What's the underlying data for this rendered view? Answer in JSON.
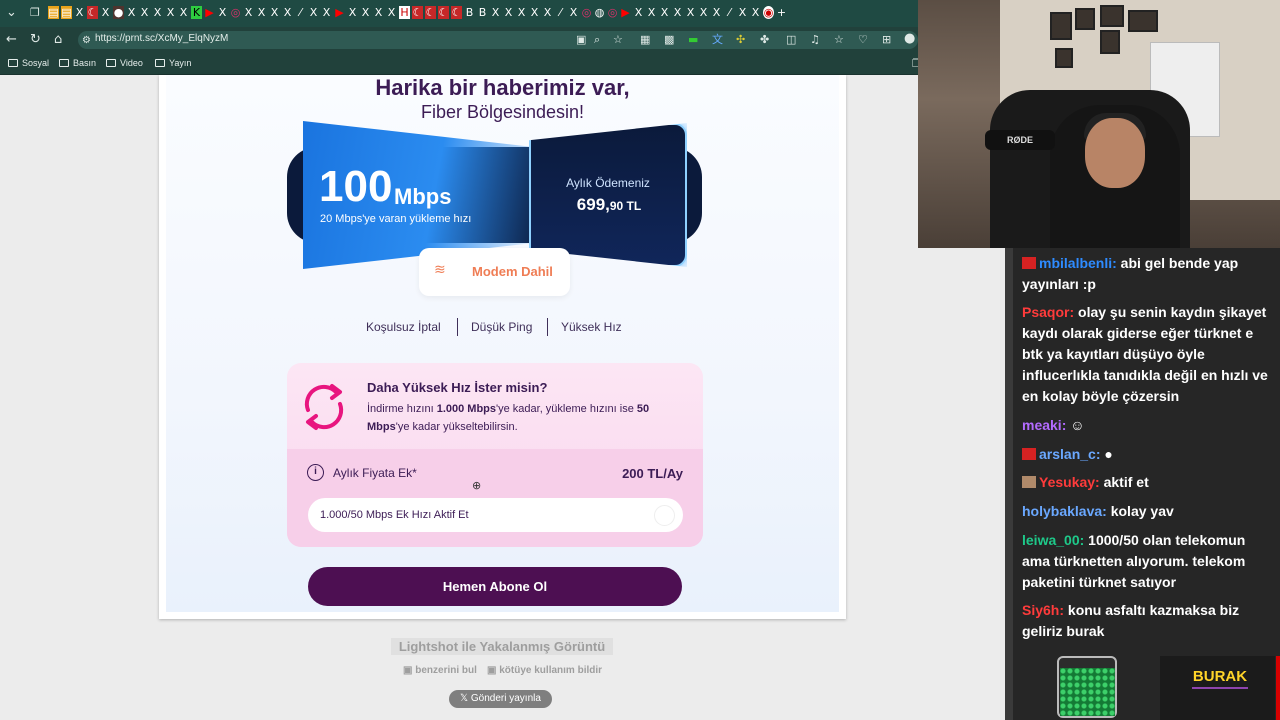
{
  "browser": {
    "url": "https://prnt.sc/XcMy_ElqNyzM",
    "bookmarks": [
      "Sosyal",
      "Basın",
      "Video",
      "Yayın"
    ]
  },
  "offer": {
    "headline": "Harika bir haberimiz var,",
    "subheadline": "Fiber Bölgesindesin!",
    "speed_value": "100",
    "speed_unit": "Mbps",
    "upload_text": "20 Mbps'ye varan yükleme hızı",
    "price_label": "Aylık Ödemeniz",
    "price_main": "699,",
    "price_decimals": "90 TL",
    "modem_label": "Modem Dahil",
    "features": [
      "Koşulsuz İptal",
      "Düşük Ping",
      "Yüksek Hız"
    ]
  },
  "upgrade": {
    "title": "Daha Yüksek Hız İster misin?",
    "desc_a": "İndirme hızını ",
    "desc_b": "1.000 Mbps",
    "desc_c": "'ye kadar, yükleme hızını ise ",
    "desc_d": "50 Mbps",
    "desc_e": "'ye kadar yükseltebilirsin.",
    "extra_label": "Aylık Fiyata Ek*",
    "extra_value": "200 TL/Ay",
    "toggle_label": "1.000/50 Mbps Ek Hızı Aktif Et",
    "subscribe_label": "Hemen Abone Ol"
  },
  "lightshot": {
    "title": "Lightshot ile Yakalanmış Görüntü",
    "find_similar": "benzerini bul",
    "report": "kötüye kullanım bildir",
    "post": "Gönderi yayınla"
  },
  "webcam": {
    "mic_label": "RØDE"
  },
  "chat": [
    {
      "user": "mbilalbenli:",
      "text": " abi gel bende yap yayınları :p",
      "color": "#2e8bff"
    },
    {
      "user": "Psaqor:",
      "text": " olay şu senin kaydın şikayet kaydı olarak giderse eğer türknet e btk ya kayıtları düşüyo öyle influcerlıkla tanıdıkla değil en hızlı ve en kolay böyle çözersin",
      "color": "#ff3b3b"
    },
    {
      "user": "meaki:",
      "text": "",
      "color": "#b36bff"
    },
    {
      "user": "arslan_c:",
      "text": "",
      "color": "#6aa8ff"
    },
    {
      "user": "Yesukay:",
      "text": " aktif et",
      "color": "#ff3b3b"
    },
    {
      "user": "holybaklava:",
      "text": " kolay yav",
      "color": "#6aa8ff"
    },
    {
      "user": "leiwa_00:",
      "text": " 1000/50 olan telekomun ama türknetten alıyorum. telekom paketini türknet satıyor",
      "color": "#1ec98a"
    },
    {
      "user": "Siy6h:",
      "text": " konu asfaltı kazmaksa biz geliriz burak",
      "color": "#ff3b3b"
    }
  ],
  "overlay": {
    "name": "BURAK"
  }
}
